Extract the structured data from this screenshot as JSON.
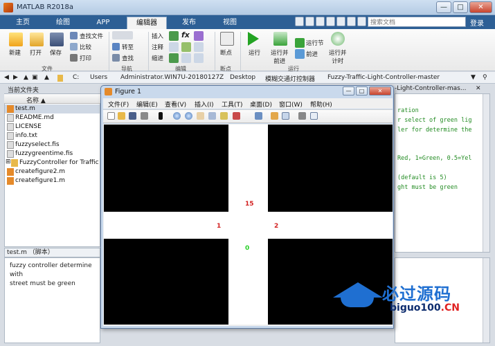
{
  "window": {
    "title": "MATLAB R2018a",
    "min": "—",
    "max": "□",
    "close": "✕"
  },
  "tabs": [
    "主页",
    "绘图",
    "APP",
    "编辑器",
    "发布",
    "视图"
  ],
  "search": {
    "placeholder": "搜索文档"
  },
  "login": "登录",
  "ribbon": {
    "file": {
      "new": "新建",
      "open": "打开",
      "save": "保存",
      "find_files": "查找文件",
      "compare": "比较",
      "print": "打印",
      "label": "文件"
    },
    "navigate": {
      "goto": "转至",
      "find": "查找",
      "label": "导航"
    },
    "edit": {
      "insert": "插入",
      "comment": "注释",
      "indent": "缩进",
      "fx": "fx",
      "label": "编辑"
    },
    "breakpoints": {
      "bp": "断点",
      "label": "断点"
    },
    "run": {
      "run": "运行",
      "run_advance": "运行并\n前进",
      "run_section": "运行节",
      "advance": "前进",
      "run_time": "运行并\n计时",
      "label": "运行"
    }
  },
  "address": [
    "C:",
    "Users",
    "Administrator.WIN7U-20180127Z",
    "Desktop",
    "模糊交通灯控制器",
    "Fuzzy-Traffic-Light-Controller-master"
  ],
  "current_folder": {
    "title": "当前文件夹",
    "column": "名称 ▲",
    "files": [
      "test.m",
      "README.md",
      "LICENSE",
      "info.txt",
      "fuzzyselect.fis",
      "fuzzygreentime.fis",
      "FuzzyController for Traffic",
      "createfigure2.m",
      "createfigure1.m"
    ]
  },
  "details": {
    "title": "test.m （脚本）",
    "text": "fuzzy controller determine with\nstreet must be green"
  },
  "editor_lines": [
    "ration",
    "r select of green lig",
    "ler for determine the",
    "",
    "",
    "Red, 1=Green, 0.5=Yel",
    "",
    "",
    " (default is 5)",
    "ght must be green"
  ],
  "editor_tab": "-Light-Controller-mas...",
  "figure": {
    "title": "Figure 1",
    "menus": [
      "文件(F)",
      "编辑(E)",
      "查看(V)",
      "插入(I)",
      "工具(T)",
      "桌面(D)",
      "窗口(W)",
      "帮助(H)"
    ],
    "labels": {
      "top": "15",
      "left": "1",
      "right": "2",
      "bottom": "0"
    },
    "colors": {
      "red": "#d22020",
      "green": "#2ad12a"
    }
  },
  "watermark": {
    "title": "必过源码",
    "url_a": "biguo100",
    "url_b": ".CN"
  }
}
